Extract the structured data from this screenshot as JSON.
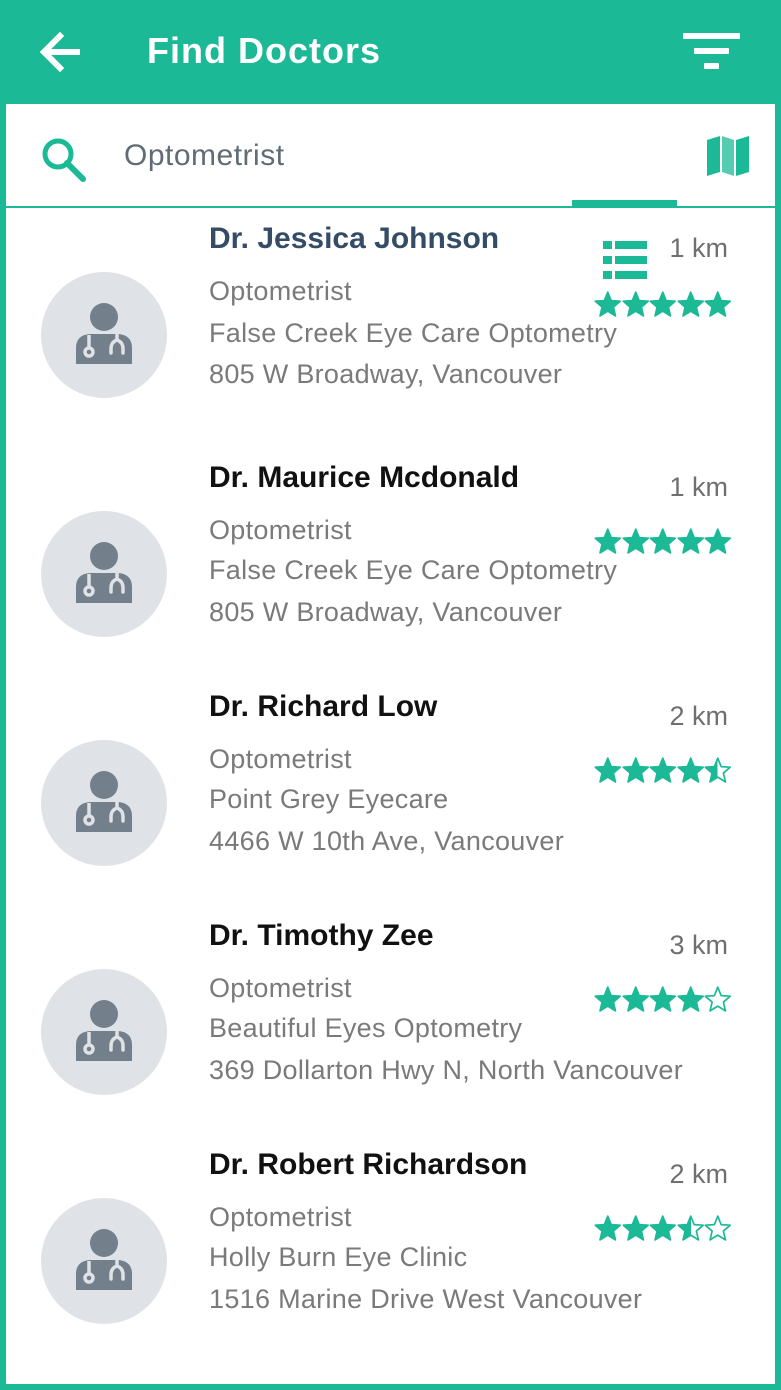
{
  "header": {
    "title": "Find Doctors"
  },
  "search": {
    "value": "Optometrist"
  },
  "colors": {
    "accent": "#1cb997",
    "avatar_bg": "#dfe2e6",
    "avatar_fg": "#737f8b"
  },
  "icons": {
    "back": "arrow-left-icon",
    "filter": "filter-icon",
    "search": "search-icon",
    "list": "list-icon",
    "map": "map-icon",
    "avatar": "doctor-icon",
    "rating": "star-icon"
  },
  "doctors": [
    {
      "name": "Dr. Jessica Johnson",
      "specialty": "Optometrist",
      "clinic": "False Creek Eye Care Optometry",
      "address": "805 W Broadway, Vancouver",
      "distance": "1 km",
      "rating": 5
    },
    {
      "name": "Dr. Maurice Mcdonald",
      "specialty": "Optometrist",
      "clinic": "False Creek Eye Care Optometry",
      "address": "805 W Broadway, Vancouver",
      "distance": "1 km",
      "rating": 5
    },
    {
      "name": "Dr. Richard Low",
      "specialty": "Optometrist",
      "clinic": "Point Grey Eyecare",
      "address": "4466 W 10th Ave, Vancouver",
      "distance": "2 km",
      "rating": 4.5
    },
    {
      "name": "Dr. Timothy Zee",
      "specialty": "Optometrist",
      "clinic": "Beautiful Eyes Optometry",
      "address": "369 Dollarton Hwy N, North Vancouver",
      "distance": "3 km",
      "rating": 4
    },
    {
      "name": "Dr. Robert Richardson",
      "specialty": "Optometrist",
      "clinic": "Holly Burn Eye Clinic",
      "address": "1516 Marine Drive West Vancouver",
      "distance": "2 km",
      "rating": 3.5
    }
  ]
}
